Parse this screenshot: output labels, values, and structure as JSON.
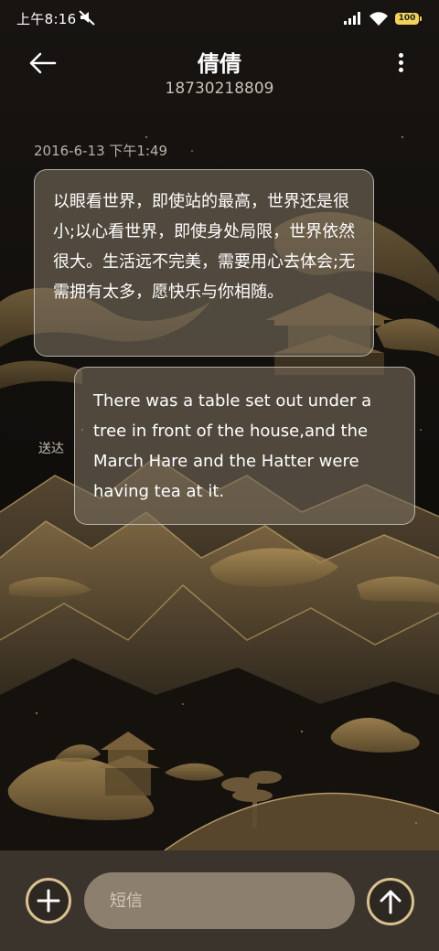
{
  "status_bar": {
    "time": "上午8:16",
    "battery": "100"
  },
  "header": {
    "contact_name": "倩倩",
    "contact_number": "18730218809"
  },
  "conversation": {
    "timestamp": "2016-6-13 下午1:49",
    "received_message": "以眼看世界，即使站的最高，世界还是很小;以心看世界，即使身处局限，世界依然很大。生活远不完美，需要用心去体会;无需拥有太多，愿快乐与你相随。",
    "sent_message": "There was a table set out under a tree in front of the house,and the March Hare and the Hatter were having tea at it.",
    "delivery_status": "送达"
  },
  "composer": {
    "placeholder": "短信"
  },
  "icons": {
    "back": "arrow-left-icon",
    "more": "more-vertical-icon",
    "add": "plus-icon",
    "send": "arrow-up-icon",
    "mute": "mute-icon",
    "signal": "signal-icon",
    "wifi": "wifi-icon",
    "battery": "battery-icon"
  },
  "colors": {
    "accent_gold": "#d9c08e",
    "bubble_fill": "#786c5c",
    "composer_bg": "#3a342d",
    "input_bg": "#8c7f6e"
  }
}
